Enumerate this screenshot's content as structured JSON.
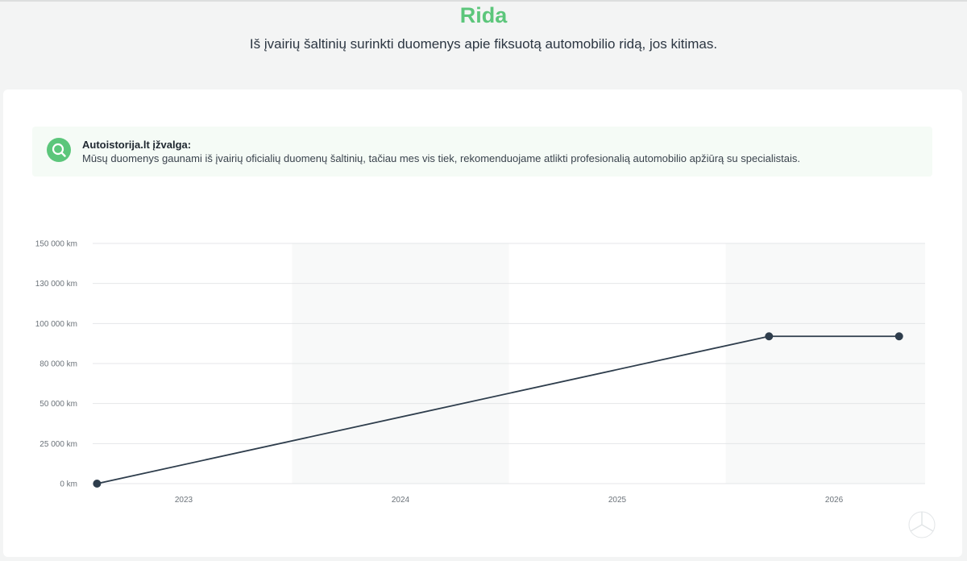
{
  "header": {
    "title": "Rida",
    "subtitle": "Iš įvairių šaltinių surinkti duomenys apie fiksuotą automobilio ridą, jos kitimas."
  },
  "insight": {
    "title": "Autoistorija.lt įžvalga:",
    "text": "Mūsų duomenys gaunami iš įvairių oficialių duomenų šaltinių, tačiau mes vis tiek, rekomenduojame atlikti profesionalią automobilio apžiūrą su specialistais.",
    "icon": "search-icon"
  },
  "colors": {
    "accent": "#5cc67b",
    "line": "#2e3d4c",
    "band": "#f8f9f9",
    "grid": "#e4e6e8"
  },
  "chart_data": {
    "type": "line",
    "title": "",
    "xlabel": "",
    "ylabel": "",
    "y_tick_labels": [
      "0 km",
      "25 000 km",
      "50 000 km",
      "80 000 km",
      "100 000 km",
      "130 000 km",
      "150 000 km"
    ],
    "x_tick_labels": [
      "2023",
      "2024",
      "2025",
      "2026"
    ],
    "series": [
      {
        "points": [
          {
            "x": 2022.6,
            "y": 0
          },
          {
            "x": 2025.7,
            "y": 92000
          },
          {
            "x": 2026.3,
            "y": 92000
          }
        ]
      }
    ],
    "xlim": [
      2022.58,
      2026.42
    ],
    "ylim": [
      0,
      150000
    ],
    "grid": true,
    "alternating_year_bands": true,
    "legend": "none"
  }
}
